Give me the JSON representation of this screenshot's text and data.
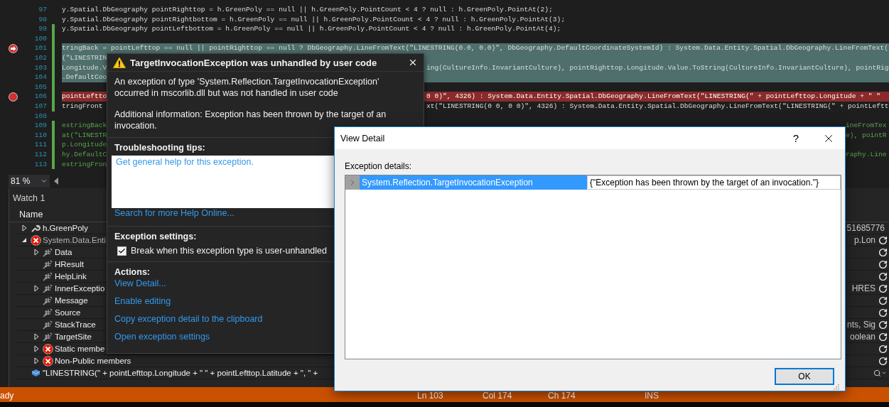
{
  "editor": {
    "lines": [
      {
        "number": "97",
        "kind": "plain",
        "changed": false,
        "code": "y.Spatial.DbGeography pointRighttop = h.GreenPoly == null || h.GreenPoly.PointCount < 4 ? null : h.GreenPoly.PointAt(2);"
      },
      {
        "number": "98",
        "kind": "plain",
        "changed": false,
        "code": "y.Spatial.DbGeography pointRightbottom = h.GreenPoly == null || h.GreenPoly.PointCount < 4 ? null : h.GreenPoly.PointAt(3);"
      },
      {
        "number": "99",
        "kind": "plain",
        "changed": true,
        "code": "y.Spatial.DbGeography pointLeftbottom = h.GreenPoly == null || h.GreenPoly.PointCount < 4 ? null : h.GreenPoly.PointAt(4);"
      },
      {
        "number": "100",
        "kind": "plain",
        "changed": true
      },
      {
        "number": "101",
        "kind": "selected",
        "changed": true,
        "breakpoint": true,
        "current_statement": true,
        "code": "tringBack = pointLefttop == null || pointRighttop == null ? DbGeography.LineFromText(\"LINESTRING(0.0, 0.0)\", DbGeography.DefaultCoordinateSystemId) : System.Data.Entity.Spatial.DbGeography.LineFromText("
      },
      {
        "number": "102",
        "kind": "selected",
        "changed": true,
        "left": "(\"LINESTRIN"
      },
      {
        "number": "103",
        "kind": "selected",
        "changed": true,
        "left": "Longitude.V",
        "right": "ing(CultureInfo.InvariantCulture), pointRighttop.Longitude.Value.ToString(CultureInfo.InvariantCulture), pointRig"
      },
      {
        "number": "104",
        "kind": "selected",
        "changed": true,
        "left": ".DefaultCoo"
      },
      {
        "number": "105",
        "kind": "plain",
        "changed": true
      },
      {
        "number": "106",
        "kind": "error",
        "changed": true,
        "breakpoint": true,
        "current_statement": false,
        "left": "pointLeftto",
        "right": "0 0)\", 4326) : System.Data.Entity.Spatial.DbGeography.LineFromText(\"LINESTRING(\" + pointLefttop.Longitude + \" \""
      },
      {
        "number": "107",
        "kind": "plain",
        "changed": true,
        "left": "tringFront",
        "right": "xt(\"LINESTRING(0 0, 0 0)\", 4326) : System.Data.Entity.Spatial.DbGeography.LineFromText(\"LINESTRING(\" + pointLeftt"
      },
      {
        "number": "108",
        "kind": "plain",
        "changed": false
      },
      {
        "number": "109",
        "kind": "comment",
        "changed": true,
        "left": "estringBack",
        "edge": "ineFromTex"
      },
      {
        "number": "110",
        "kind": "comment",
        "changed": true,
        "left": "at(\"LINESTR",
        "edge": "e), pointR"
      },
      {
        "number": "111",
        "kind": "comment",
        "changed": true,
        "left": "p.Longitude"
      },
      {
        "number": "112",
        "kind": "comment",
        "changed": true,
        "left": "hy.DefaultC",
        "edge": "raphy.Line"
      },
      {
        "number": "113",
        "kind": "comment",
        "changed": true,
        "left": "estringFron"
      }
    ]
  },
  "zoom": {
    "value": "81 %"
  },
  "watch": {
    "title": "Watch 1",
    "columns": [
      "Name"
    ],
    "items": [
      {
        "name": "h.GreenPoly",
        "kind": "wrench",
        "expanded": false,
        "value": "51685776",
        "refresh": false
      },
      {
        "name": "System.Data.Enti",
        "kind": "error",
        "expanded": true,
        "value": "p.Lon",
        "refresh": true,
        "children": [
          {
            "name": "Data",
            "kind": "field",
            "expanded": false,
            "refresh": true
          },
          {
            "name": "HResult",
            "kind": "field",
            "refresh": true
          },
          {
            "name": "HelpLink",
            "kind": "field",
            "refresh": true
          },
          {
            "name": "InnerExceptio",
            "kind": "field",
            "expanded": false,
            "value": "HRES",
            "refresh": true
          },
          {
            "name": "Message",
            "kind": "field",
            "refresh": true
          },
          {
            "name": "Source",
            "kind": "field",
            "refresh": true
          },
          {
            "name": "StackTrace",
            "kind": "field",
            "value": "nts, Sig",
            "refresh": true
          },
          {
            "name": "TargetSite",
            "kind": "field",
            "expanded": false,
            "value": "oolean",
            "refresh": true
          },
          {
            "name": "Static membe",
            "kind": "error",
            "expanded": false,
            "refresh": true
          },
          {
            "name": "Non-Public members",
            "kind": "error",
            "expanded": false,
            "refresh": true
          }
        ]
      },
      {
        "name": "\"LINESTRING(\" + pointLefttop.Longitude + \" \" + pointLefttop.Latitude + \", \" +",
        "kind": "cube",
        "refresh": false,
        "search": true
      }
    ]
  },
  "exception_popup": {
    "title": "TargetInvocationException was unhandled by user code",
    "message": "An exception of type 'System.Reflection.TargetInvocationException' occurred in mscorlib.dll but was not handled in user code",
    "additional_info": "Additional information: Exception has been thrown by the target of an invocation.",
    "tips_heading": "Troubleshooting tips:",
    "tips": [
      "Get general help for this exception."
    ],
    "help_link": "Search for more Help Online...",
    "settings_heading": "Exception settings:",
    "settings": [
      {
        "label": "Break when this exception type is user-unhandled",
        "checked": true
      }
    ],
    "actions_heading": "Actions:",
    "actions": [
      "View Detail...",
      "Enable editing",
      "Copy exception detail to the clipboard",
      "Open exception settings"
    ]
  },
  "view_detail": {
    "title": "View Detail",
    "help": "?",
    "label": "Exception details:",
    "rows": [
      {
        "name": "System.Reflection.TargetInvocationException",
        "value": "{\"Exception has been thrown by the target of an invocation.\"}",
        "selected": true,
        "expanded": false
      }
    ],
    "buttons": [
      "OK"
    ]
  },
  "status_bar": {
    "items": [
      "ady",
      "Ln 103",
      "Col 174",
      "Ch 174",
      "INS"
    ]
  }
}
